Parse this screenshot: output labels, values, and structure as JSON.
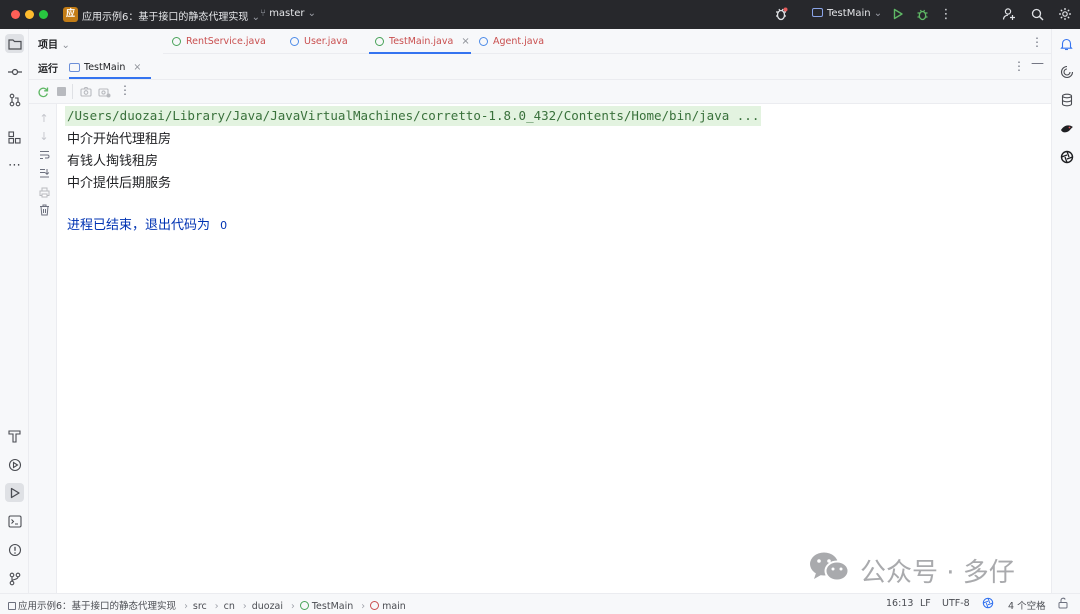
{
  "window": {
    "project_badge": "应",
    "project_name": "应用示例6：基于接口的静态代理实现",
    "branch": "master",
    "run_config": "TestMain"
  },
  "tool_window": {
    "project_label": "项目",
    "run_label": "运行",
    "run_tab": "TestMain"
  },
  "editor_tabs": [
    {
      "label": "RentService.java",
      "color": "#c94f4f"
    },
    {
      "label": "User.java",
      "color": "#c94f4f"
    },
    {
      "label": "TestMain.java",
      "color": "#c94f4f"
    },
    {
      "label": "Agent.java",
      "color": "#c94f4f"
    }
  ],
  "console": {
    "command": "/Users/duozai/Library/Java/JavaVirtualMachines/corretto-1.8.0_432/Contents/Home/bin/java ...",
    "lines": [
      "中介开始代理租房",
      "有钱人掏钱租房",
      "中介提供后期服务"
    ],
    "exit_text": "进程已结束，退出代码为",
    "exit_code": "0"
  },
  "breadcrumb": {
    "project": "应用示例6：基于接口的静态代理实现",
    "items": [
      "src",
      "cn",
      "duozai",
      "TestMain",
      "main"
    ]
  },
  "status": {
    "position": "16:13",
    "line_sep": "LF",
    "encoding": "UTF-8",
    "indent": "4 个空格"
  },
  "watermark": {
    "text": "公众号 · 多仔"
  },
  "colors": {
    "accent": "#3574f0",
    "command_bg": "#e3f3e0",
    "command_fg": "#39713b",
    "exit_fg": "#0033b3",
    "tab_modified": "#c94f4f",
    "run_green": "#5fb865"
  }
}
